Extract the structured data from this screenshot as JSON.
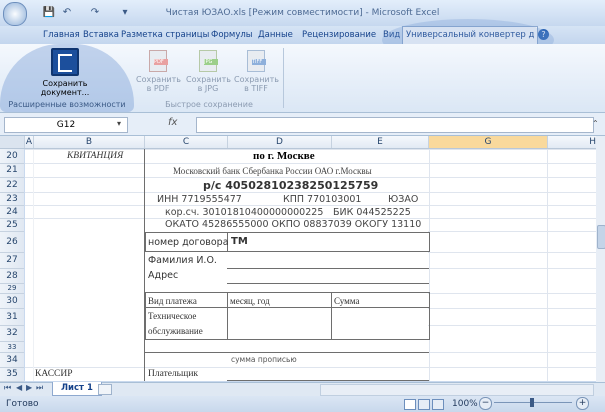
{
  "window": {
    "title": "Чистая ЮЗАО.xls  [Режим совместимости] - Microsoft Excel"
  },
  "tabs": [
    "Главная",
    "Вставка",
    "Разметка страницы",
    "Формулы",
    "Данные",
    "Рецензирование",
    "Вид",
    "Универсальный конвертер д"
  ],
  "ribbon": {
    "save_doc": "Сохранить документ...",
    "save_pdf": "Сохранить в PDF",
    "save_jpg": "Сохранить в JPG",
    "save_tiff": "Сохранить в TIFF",
    "group1": "Расширенные возможности",
    "group2": "Быстрое сохранение"
  },
  "formula_bar": {
    "name_box": "G12",
    "fx": "fx"
  },
  "columns": [
    "A",
    "B",
    "C",
    "D",
    "E",
    "G",
    "H"
  ],
  "rows": [
    "20",
    "21",
    "22",
    "23",
    "24",
    "25",
    "26",
    "27",
    "28",
    "29",
    "30",
    "31",
    "32",
    "33",
    "34",
    "35"
  ],
  "sheet": {
    "kvitanciya": "КВИТАНЦИЯ",
    "city": "по г. Москве",
    "bank": "Московский банк Сбербанка России ОАО г.Москвы",
    "account": "р/с 40502810238250125759",
    "inn": "ИНН 7719555477",
    "kpp": "КПП 770103001",
    "yuzao": "ЮЗАО",
    "korr": "кор.сч. 30101810400000000225",
    "bik": "БИК 044525225",
    "okato": "ОКАТО 45286555000 ОКПО 08837039 ОКОГУ 13110",
    "contract_label": "номер договора",
    "contract_value": "ТМ",
    "fio": "Фамилия И.О.",
    "address": "Адрес",
    "payment_type": "Вид платежа",
    "month_year": "месяц,  год",
    "sum": "Сумма",
    "tech1": "Техническое",
    "tech2": "обслуживание",
    "sum_words": "сумма прописью",
    "kassir": "КАССИР",
    "payer": "Плательщик"
  },
  "sheet_tab": "Лист 1",
  "status": {
    "ready": "Готово",
    "zoom": "100%"
  }
}
